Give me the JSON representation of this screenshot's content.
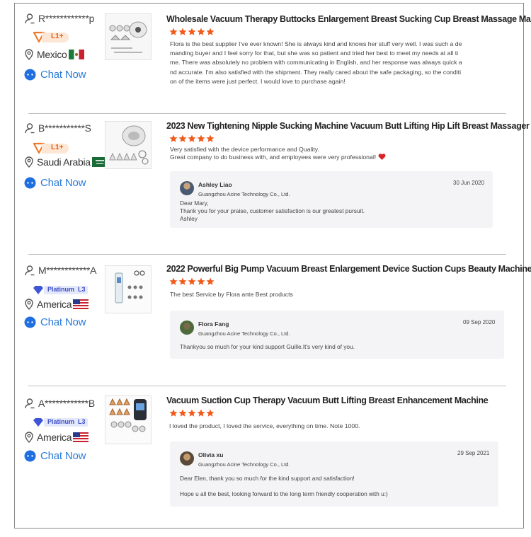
{
  "chat_label": "Chat Now",
  "colors": {
    "star": "#f05a1a",
    "chat": "#2b7bd8",
    "badge_l1": "#f07a2a",
    "badge_platinum": "#3d55d6"
  },
  "reviews": [
    {
      "buyer": "R************p",
      "level": "L1+",
      "level_type": "orange",
      "country": "Mexico",
      "product_title": "Wholesale Vacuum Therapy Buttocks Enlargement Breast Sucking Cup Breast Massage Machine",
      "stars": 5,
      "text_lines": [
        "Flora is the best supplier I've ever known! She is always kind and knows her stuff very well. I was such a de",
        "manding buyer and I feel sorry for that, but she was so patient and tried her best to meet my needs at all ti",
        "me. There was absolutely no problem with communicating in English, and her response was always quick a",
        "nd accurate. I'm also satisfied with the shipment. They really cared about the safe packaging, so the conditi",
        "on of the items were just perfect. I would love to purchase again!"
      ]
    },
    {
      "buyer": "B***********S",
      "level": "L1+",
      "level_type": "orange",
      "country": "Saudi Arabia",
      "product_title": "2023 New Tightening Nipple Sucking Machine Vacuum Butt Lifting Hip Lift Breast Massager",
      "stars": 5,
      "text_lines": [
        "Very satisfied with the device performance and Quality.",
        "Great company to do business with, and employees were very professional!"
      ],
      "reply": {
        "name": "Ashley Liao",
        "company": "Guangzhou Acine Technology Co., Ltd.",
        "date": "30 Jun 2020",
        "lines": [
          "Dear Mary,",
          "Thank you for your praise, customer satisfaction is our greatest pursuit.",
          "Ashley"
        ]
      }
    },
    {
      "buyer": "M************A",
      "level": "Platinum",
      "level_num": "L3",
      "level_type": "platinum",
      "country": "America",
      "product_title": "2022 Powerful Big Pump Vacuum Breast Enlargement Device Suction Cups Beauty Machine",
      "stars": 5,
      "text_lines": [
        "The best Service by Flora ante Best products"
      ],
      "reply": {
        "name": "Flora Fang",
        "company": "Guangzhou Acine Technology Co., Ltd.",
        "date": "09 Sep 2020",
        "lines": [
          "Thankyou so much for your kind support Guille.It's very kind of you."
        ]
      }
    },
    {
      "buyer": "A************B",
      "level": "Platinum",
      "level_num": "L3",
      "level_type": "platinum",
      "country": "America",
      "product_title": "Vacuum Suction Cup Therapy Vacuum Butt Lifting Breast Enhancement Machine",
      "stars": 5,
      "text_lines": [
        "I loved the product, I loved the service, everything on time.  Note 1000."
      ],
      "reply": {
        "name": "Olivia xu",
        "company": "Guangzhou Acine Technology Co., Ltd.",
        "date": "29 Sep 2021",
        "lines": [
          "Dear Elen, thank you so much for the kind support and satisfaction!",
          "",
          "Hope u all the best, looking forward to the long term friendly cooperation with u:)"
        ]
      }
    }
  ]
}
